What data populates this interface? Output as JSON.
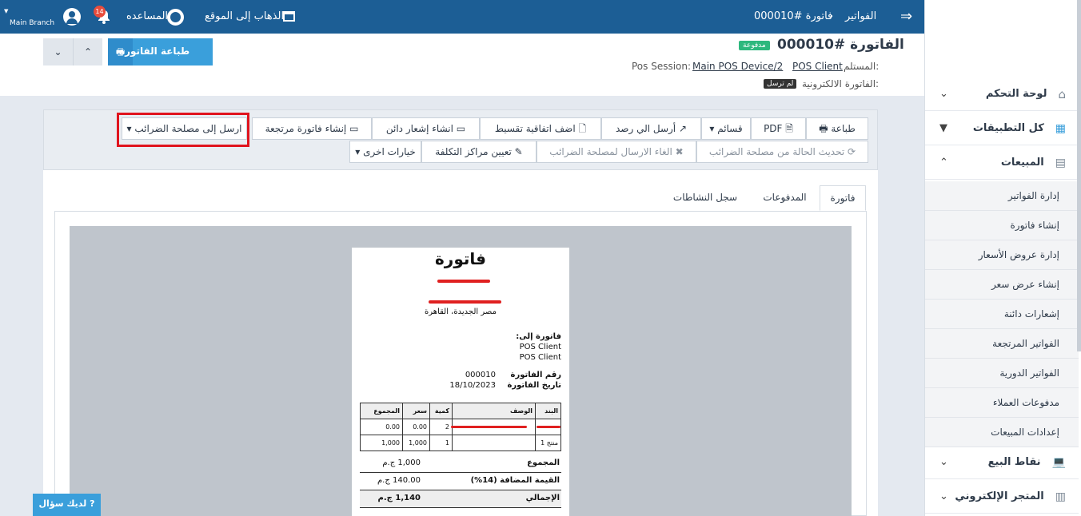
{
  "topbar": {
    "branch": "Main Branch",
    "notifications": "14",
    "help": "المساعده",
    "go_to_site": "الذهاب إلى الموقع",
    "breadcrumb_parent": "الفواتير",
    "breadcrumb_current": "فاتورة #000010"
  },
  "header": {
    "title": "الفاتورة #000010",
    "status_badge": "مدفوعة",
    "recipient_label": "المستلم:",
    "recipient": "POS Client",
    "session_label": "Pos Session:",
    "session": "Main POS Device/2",
    "einvoice_label": "الفاتورة الالكترونية:",
    "einvoice_badge": "لم ترسل",
    "print_button": "طباعة الفاتورة"
  },
  "toolbar": {
    "row1": [
      "طباعة",
      "PDF",
      "قسائم",
      "أرسل الي رصد",
      "اضف اتفاقية تقسيط",
      "انشاء إشعار دائن",
      "إنشاء فاتورة مرتجعة",
      "ارسل إلى مصلحة الضرائب"
    ],
    "row2": [
      "تحديث الحالة من مصلحة الضرائب",
      "الغاء الارسال لمصلحة الضرائب",
      "تعيين مراكز التكلفة",
      "خيارات اخرى"
    ]
  },
  "tabs": [
    "فاتورة",
    "المدفوعات",
    "سجل النشاطات"
  ],
  "invoice": {
    "heading": "فاتورة",
    "address": "مصر الجديدة، القاهرة",
    "bill_to_label": "فاتورة إلى:",
    "bill_to_1": "POS Client",
    "bill_to_2": "POS Client",
    "number_label": "رقم الفاتورة",
    "number": "000010",
    "date_label": "تاريخ الفاتورة",
    "date": "18/10/2023",
    "columns": [
      "البند",
      "الوصف",
      "كمية",
      "سعر",
      "المجموع"
    ],
    "rows": [
      [
        "",
        "",
        "2",
        "0.00",
        "0.00"
      ],
      [
        "منتج 1",
        "",
        "1",
        "1,000",
        "1,000"
      ]
    ],
    "subtotal_label": "المجموع",
    "subtotal": "1,000 ج.م",
    "vat_label": "القيمة المضافة (14%)",
    "vat": "140.00 ج.م",
    "total_label": "الإجمالي",
    "total": "1,140 ج.م"
  },
  "sidebar": {
    "items": [
      {
        "label": "لوحة التحكم"
      },
      {
        "label": "كل التطبيقات"
      },
      {
        "label": "المبيعات"
      }
    ],
    "sub_items": [
      "إدارة الفواتير",
      "إنشاء فاتورة",
      "إدارة عروض الأسعار",
      "إنشاء عرض سعر",
      "إشعارات دائنة",
      "الفواتير المرتجعة",
      "الفواتير الدورية",
      "مدفوعات العملاء",
      "إعدادات المبيعات"
    ],
    "bottom_items": [
      {
        "label": "نقاط البيع"
      },
      {
        "label": "المتجر الإلكتروني"
      }
    ]
  },
  "help_widget": "لديك سؤال"
}
